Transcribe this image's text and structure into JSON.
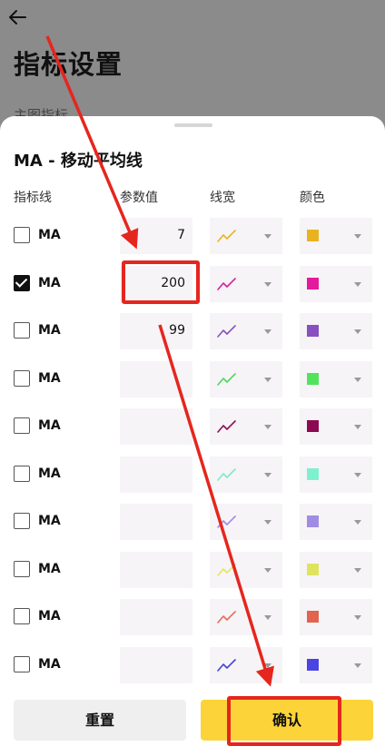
{
  "page": {
    "title": "指标设置",
    "section_peek": "主图指标"
  },
  "sheet": {
    "title": "MA - 移动平均线",
    "columns": {
      "line": "指标线",
      "param": "参数值",
      "width": "线宽",
      "color": "颜色"
    },
    "rows": [
      {
        "label": "MA",
        "checked": false,
        "param": "7",
        "line_color": "#e9b320",
        "swatch": "#e9b320"
      },
      {
        "label": "MA",
        "checked": true,
        "param": "200",
        "line_color": "#d61f9c",
        "swatch": "#e21a9b"
      },
      {
        "label": "MA",
        "checked": false,
        "param": "99",
        "line_color": "#8a4fbf",
        "swatch": "#8751c0"
      },
      {
        "label": "MA",
        "checked": false,
        "param": "",
        "line_color": "#4cd95b",
        "swatch": "#52e35c"
      },
      {
        "label": "MA",
        "checked": false,
        "param": "",
        "line_color": "#8a0f56",
        "swatch": "#8d0a52"
      },
      {
        "label": "MA",
        "checked": false,
        "param": "",
        "line_color": "#7fe9c6",
        "swatch": "#7ff0cd"
      },
      {
        "label": "MA",
        "checked": false,
        "param": "",
        "line_color": "#a488e1",
        "swatch": "#a08de3"
      },
      {
        "label": "MA",
        "checked": false,
        "param": "",
        "line_color": "#e7e463",
        "swatch": "#dfe45e"
      },
      {
        "label": "MA",
        "checked": false,
        "param": "",
        "line_color": "#ea6b58",
        "swatch": "#e2644e"
      },
      {
        "label": "MA",
        "checked": false,
        "param": "",
        "line_color": "#4242d6",
        "swatch": "#4a44e4"
      }
    ]
  },
  "buttons": {
    "reset": "重置",
    "confirm": "确认"
  },
  "colors": {
    "accent": "#fcd43a",
    "annotation": "#e5261e"
  },
  "icons": {
    "back": "arrow-left-icon",
    "line_width": "line-width-icon",
    "dropdown": "caret-down-icon"
  }
}
